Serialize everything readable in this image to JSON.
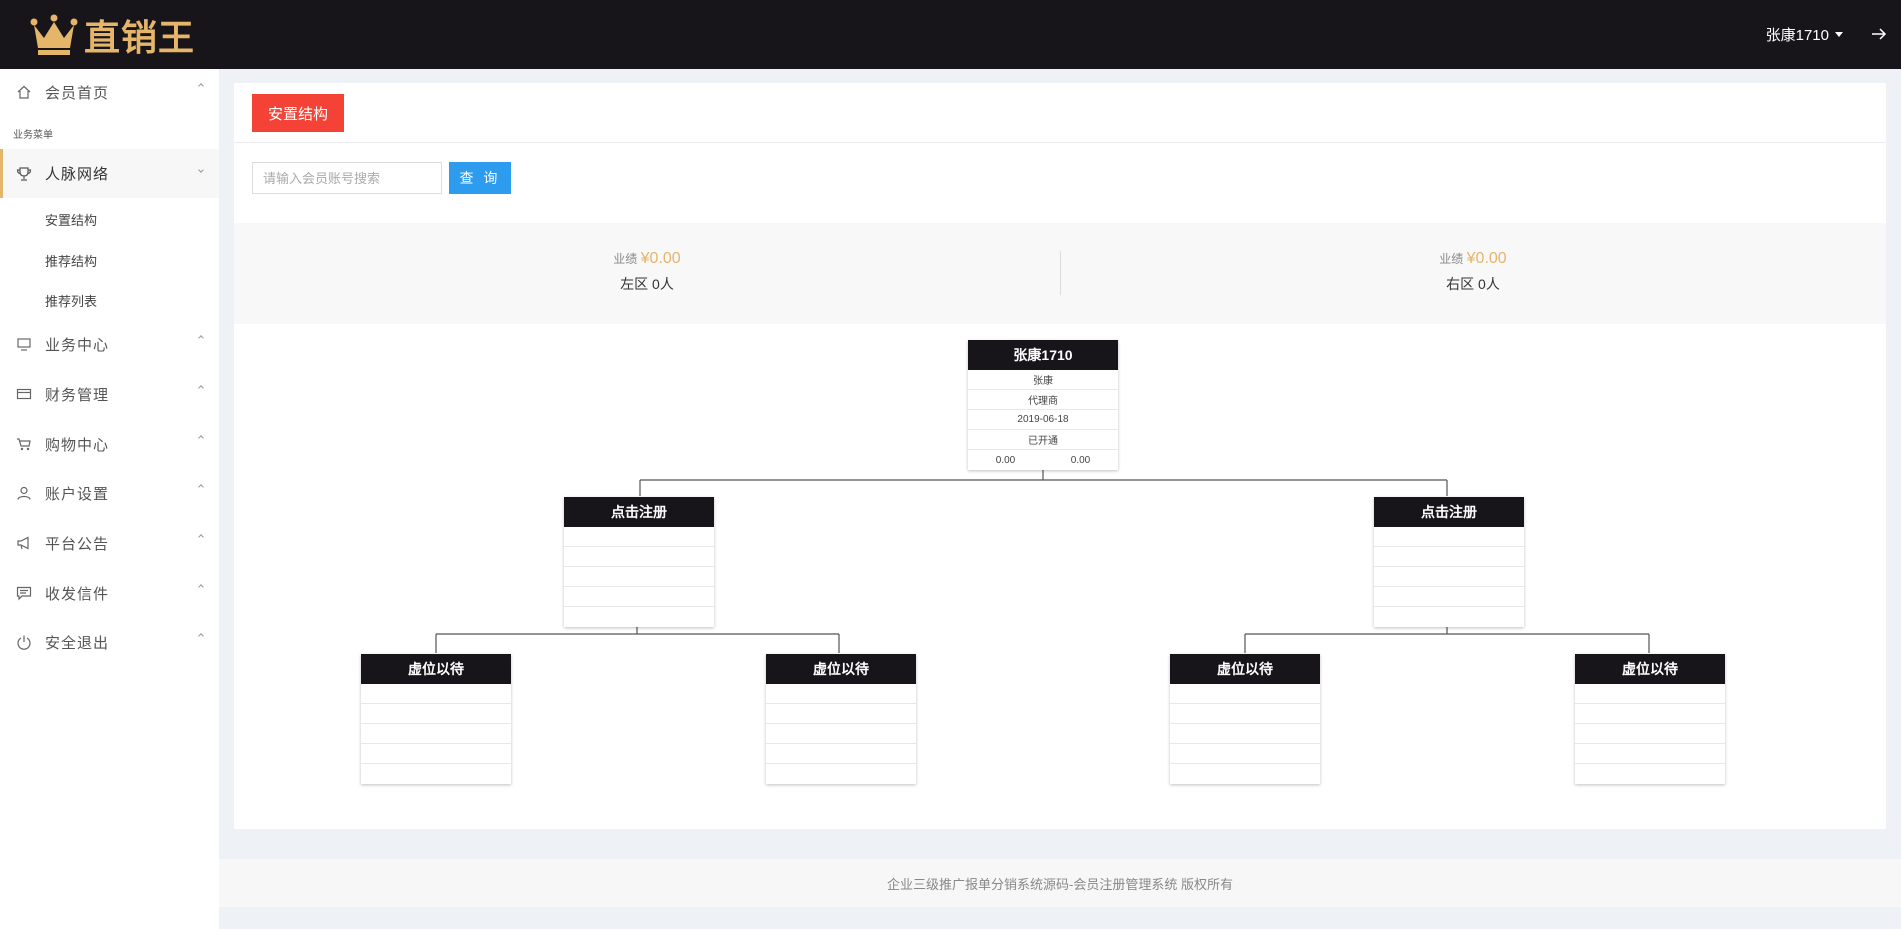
{
  "header": {
    "logo_text": "直销王",
    "user_name": "张康1710"
  },
  "sidebar": {
    "home": "会员首页",
    "section_label": "业务菜单",
    "network": "人脉网络",
    "sub_items": [
      "安置结构",
      "推荐结构",
      "推荐列表"
    ],
    "items": [
      "业务中心",
      "财务管理",
      "购物中心",
      "账户设置",
      "平台公告",
      "收发信件",
      "安全退出"
    ]
  },
  "main": {
    "tab_label": "安置结构",
    "search_placeholder": "请输入会员账号搜索",
    "search_button": "查 询",
    "left_stat": {
      "label": "业绩",
      "amount": "¥0.00",
      "zone": "左区 0人"
    },
    "right_stat": {
      "label": "业绩",
      "amount": "¥0.00",
      "zone": "右区 0人"
    }
  },
  "tree": {
    "root": {
      "title": "张康1710",
      "name": "张康",
      "level": "代理商",
      "date": "2019-06-18",
      "status": "已开通",
      "left_value": "0.00",
      "right_value": "0.00"
    },
    "level2": [
      "点击注册",
      "点击注册"
    ],
    "level3": [
      "虚位以待",
      "虚位以待",
      "虚位以待",
      "虚位以待"
    ]
  },
  "footer": {
    "text": "企业三级推广报单分销系统源码-会员注册管理系统 版权所有"
  }
}
